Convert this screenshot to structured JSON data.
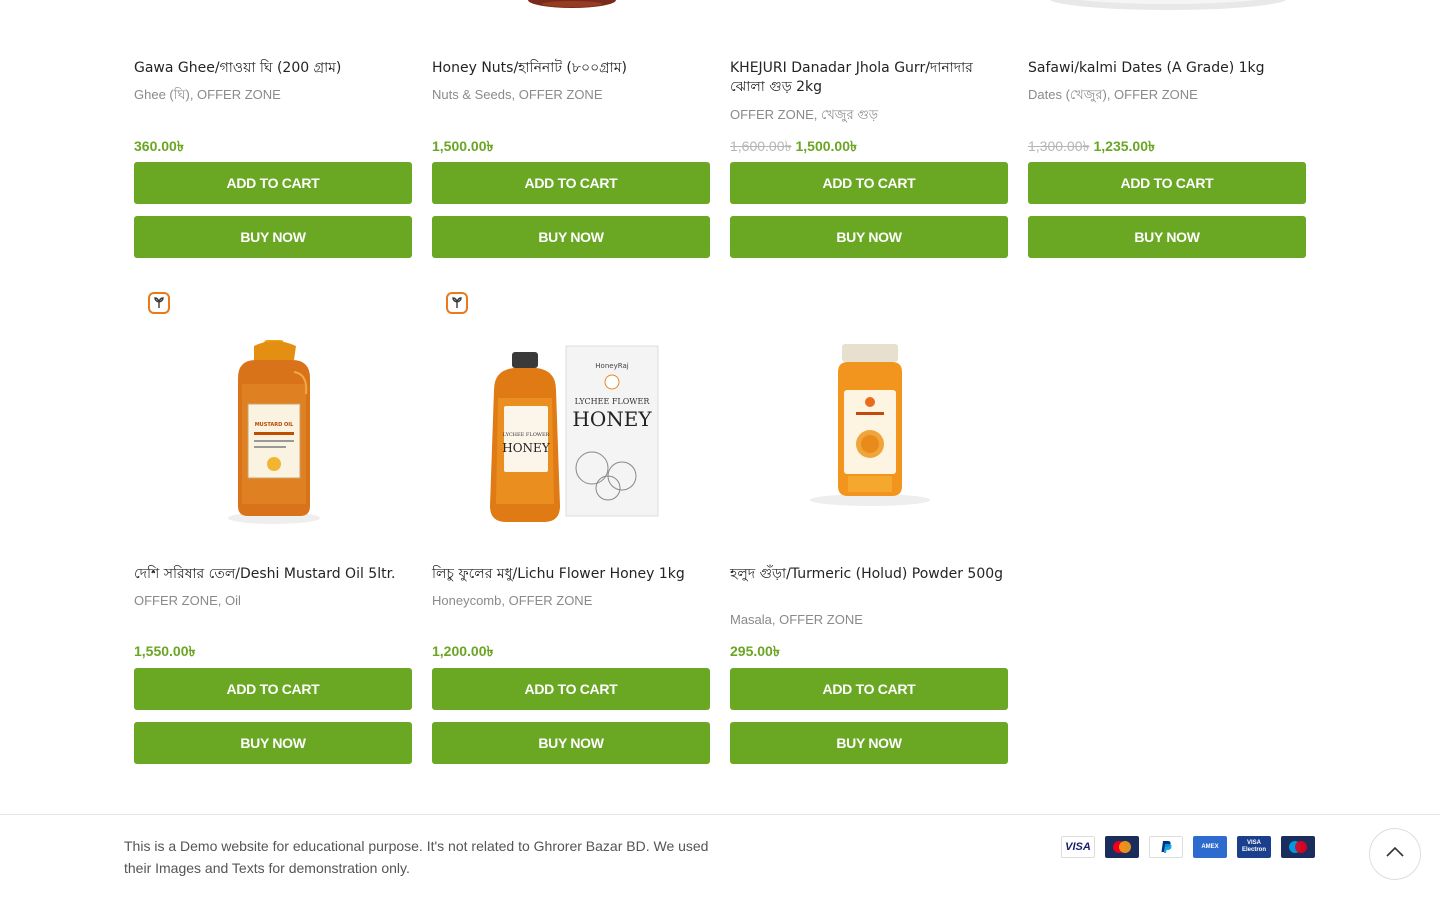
{
  "currency_symbol": "৳",
  "accent_color": "#6aa823",
  "row1": [
    {
      "title": "Gawa Ghee/গাওয়া ঘি (200 গ্রাম)",
      "categories": "Ghee (ঘি), OFFER ZONE",
      "old_price": "",
      "price": "360.00৳",
      "add_to_cart": "ADD TO CART",
      "buy_now": "BUY NOW"
    },
    {
      "title": "Honey Nuts/হানিনাট (৮০০গ্রাম)",
      "categories": "Nuts & Seeds, OFFER ZONE",
      "old_price": "",
      "price": "1,500.00৳",
      "add_to_cart": "ADD TO CART",
      "buy_now": "BUY NOW"
    },
    {
      "title": "KHEJURI Danadar Jhola Gurr/দানাদার ঝোলা গুড় 2kg",
      "categories": "OFFER ZONE, খেজুর গুড়",
      "old_price": "1,600.00৳",
      "price": "1,500.00৳",
      "add_to_cart": "ADD TO CART",
      "buy_now": "BUY NOW"
    },
    {
      "title": "Safawi/kalmi Dates (A Grade) 1kg",
      "categories": "Dates (খেজুর), OFFER ZONE",
      "old_price": "1,300.00৳",
      "price": "1,235.00৳",
      "add_to_cart": "ADD TO CART",
      "buy_now": "BUY NOW"
    }
  ],
  "row2": [
    {
      "title": "দেশি সরিষার তেল/Deshi Mustard Oil 5ltr.",
      "categories": "OFFER ZONE, Oil",
      "old_price": "",
      "price": "1,550.00৳",
      "add_to_cart": "ADD TO CART",
      "buy_now": "BUY NOW",
      "image_label": "MUSTARD OIL"
    },
    {
      "title": "লিচু ফুলের মধু/Lichu Flower Honey 1kg",
      "categories": "Honeycomb, OFFER ZONE",
      "old_price": "",
      "price": "1,200.00৳",
      "add_to_cart": "ADD TO CART",
      "buy_now": "BUY NOW",
      "image_brand": "HoneyRaj",
      "image_label_1": "LYCHEE FLOWER",
      "image_label_2": "HONEY"
    },
    {
      "title": "হলুদ গুঁড়া/Turmeric (Holud) Powder 500g",
      "categories": "Masala, OFFER ZONE",
      "old_price": "",
      "price": "295.00৳",
      "add_to_cart": "ADD TO CART",
      "buy_now": "BUY NOW"
    }
  ],
  "footer": {
    "disclaimer": "This is a Demo website for educational purpose. It's not related to Ghrorer Bazar BD. We used their Images and Texts for demonstration only.",
    "payment_methods": [
      "VISA",
      "MasterCard",
      "PayPal",
      "American Express",
      "VISA Electron",
      "Maestro"
    ]
  },
  "icons": {
    "badge": "leaf-badge-icon",
    "scroll_top": "chevron-up-icon"
  }
}
